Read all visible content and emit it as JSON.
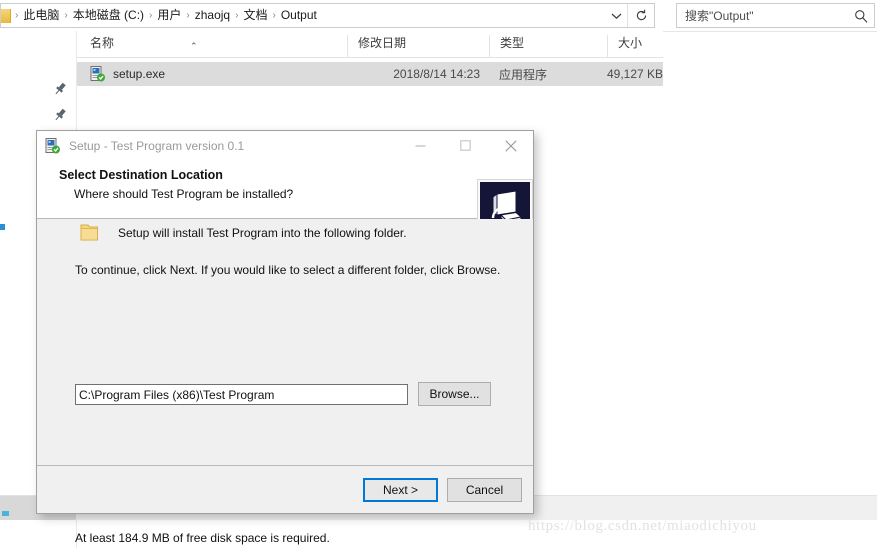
{
  "explorer": {
    "address_bar": {
      "folder_icon": "folder-icon",
      "breadcrumbs": [
        {
          "label": "此电脑"
        },
        {
          "label": "本地磁盘 (C:)"
        },
        {
          "label": "用户"
        },
        {
          "label": "zhaojq"
        },
        {
          "label": "文档"
        },
        {
          "label": "Output"
        }
      ],
      "separator": "›",
      "dropdown_icon": "chevron-down-icon",
      "refresh_icon": "refresh-icon"
    },
    "search": {
      "placeholder": "搜索\"Output\"",
      "icon": "search-icon"
    },
    "nav_pane": {
      "pin_icon": "pin-icon",
      "pins": 2
    },
    "columns": [
      {
        "key": "name",
        "label": "名称",
        "sorted": true,
        "sort_caret": "⌃"
      },
      {
        "key": "date",
        "label": "修改日期"
      },
      {
        "key": "type",
        "label": "类型"
      },
      {
        "key": "size",
        "label": "大小"
      }
    ],
    "files": [
      {
        "icon": "exe-file-icon",
        "name": "setup.exe",
        "date": "2018/8/14 14:23",
        "type": "应用程序",
        "size": "49,127 KB",
        "selected": true
      }
    ]
  },
  "dialog": {
    "icon": "setup-exe-icon",
    "title": "Setup - Test Program version 0.1",
    "window_controls": {
      "minimize": "minimize-icon",
      "maximize": "maximize-icon",
      "close": "close-icon"
    },
    "header": {
      "title": "Select Destination Location",
      "subtitle": "Where should Test Program be installed?",
      "banner_icon": "computer-install-icon"
    },
    "body": {
      "folder_icon": "folder-icon",
      "line1": "Setup will install Test Program into the following folder.",
      "line2": "To continue, click Next. If you would like to select a different folder, click Browse.",
      "path_value": "C:\\Program Files (x86)\\Test Program",
      "browse_label": "Browse...",
      "disk_space_note": "At least 184.9 MB of free disk space is required."
    },
    "footer": {
      "next_label": "Next >",
      "cancel_label": "Cancel"
    },
    "accent_color": "#0078d7"
  },
  "watermark": {
    "text": "https://blog.csdn.net/miaodichiyou"
  }
}
